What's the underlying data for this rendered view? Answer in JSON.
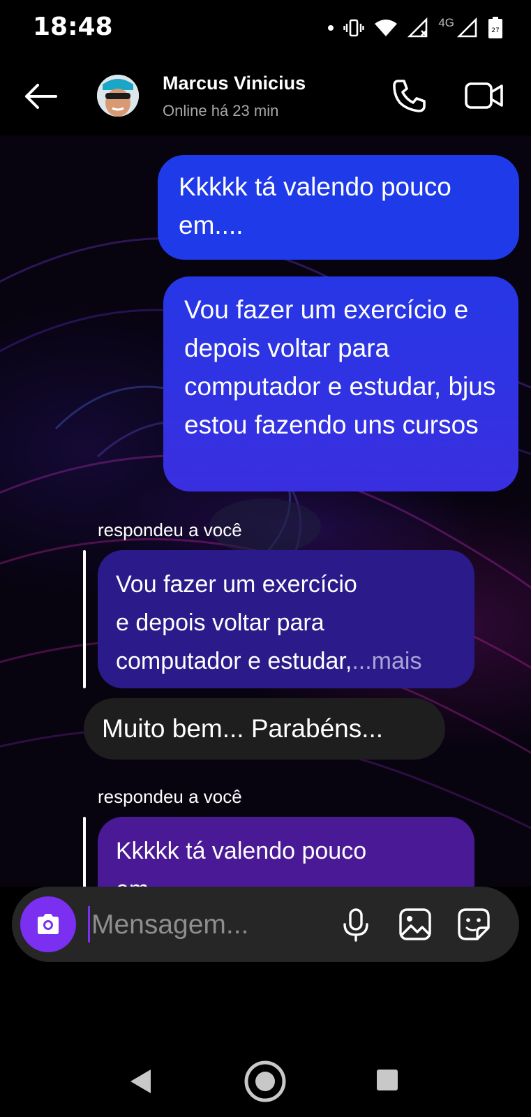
{
  "status_bar": {
    "time": "18:48",
    "network_label": "4G",
    "battery_level": "27",
    "icons": [
      "notification-dot-icon",
      "vibrate-icon",
      "wifi-icon",
      "signal-no-data-icon",
      "signal-icon",
      "battery-icon"
    ]
  },
  "header": {
    "name": "Marcus Vinicius",
    "status": "Online há 23 min",
    "icons": [
      "back-arrow-icon",
      "avatar",
      "phone-call-icon",
      "video-call-icon"
    ]
  },
  "messages": [
    {
      "type": "outgoing",
      "text": "Kkkkk tá valendo pouco em...."
    },
    {
      "type": "outgoing",
      "text": "Vou fazer um exercício e depois voltar para computador e estudar, bjus estou fazendo uns cursos"
    },
    {
      "type": "reply",
      "label": "respondeu a você",
      "quote_lines": [
        "Vou fazer um exercício",
        "e depois voltar para",
        "computador e estudar,"
      ],
      "more": "...mais"
    },
    {
      "type": "incoming",
      "text": "Muito bem... Parabéns..."
    },
    {
      "type": "reply",
      "label": "respondeu a você",
      "quote_lines": [
        "Kkkkk tá valendo pouco",
        "em...."
      ]
    }
  ],
  "composer": {
    "placeholder": "Mensagem...",
    "icons": [
      "camera-icon",
      "microphone-icon",
      "gallery-icon",
      "sticker-icon"
    ]
  },
  "colors": {
    "outgoing_bubble": "#1f3ae8",
    "quote_bubble": "#2b1a8a",
    "incoming_bubble": "#1e1e1e",
    "accent": "#7b2ff0"
  },
  "nav_bar": {
    "icons": [
      "nav-back-icon",
      "nav-home-icon",
      "nav-recents-icon"
    ]
  }
}
